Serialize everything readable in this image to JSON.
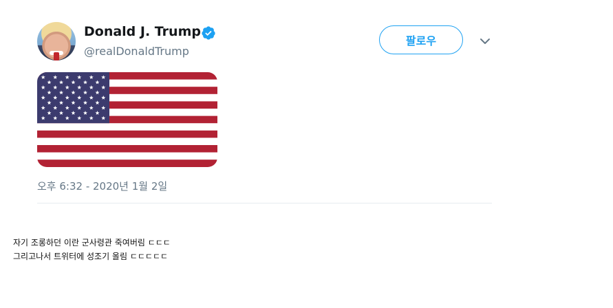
{
  "tweet": {
    "display_name": "Donald J. Trump",
    "handle": "@realDonaldTrump",
    "verified": true,
    "follow_label": "팔로우",
    "timestamp": "오후 6:32 - 2020년 1월 2일",
    "media": "us-flag-image"
  },
  "caption": {
    "line1": "자기 조롱하던 이란 군사령관 죽여버림 ㄷㄷㄷ",
    "line2": "그리고나서 트위터에 성조기 올림 ㄷㄷㄷㄷㄷ"
  },
  "colors": {
    "accent": "#1da1f2",
    "secondary_text": "#657786",
    "flag_red": "#b22234",
    "flag_blue": "#3c3b6e"
  },
  "icons": {
    "verified": "verified-badge-icon",
    "more": "chevron-down-icon"
  }
}
